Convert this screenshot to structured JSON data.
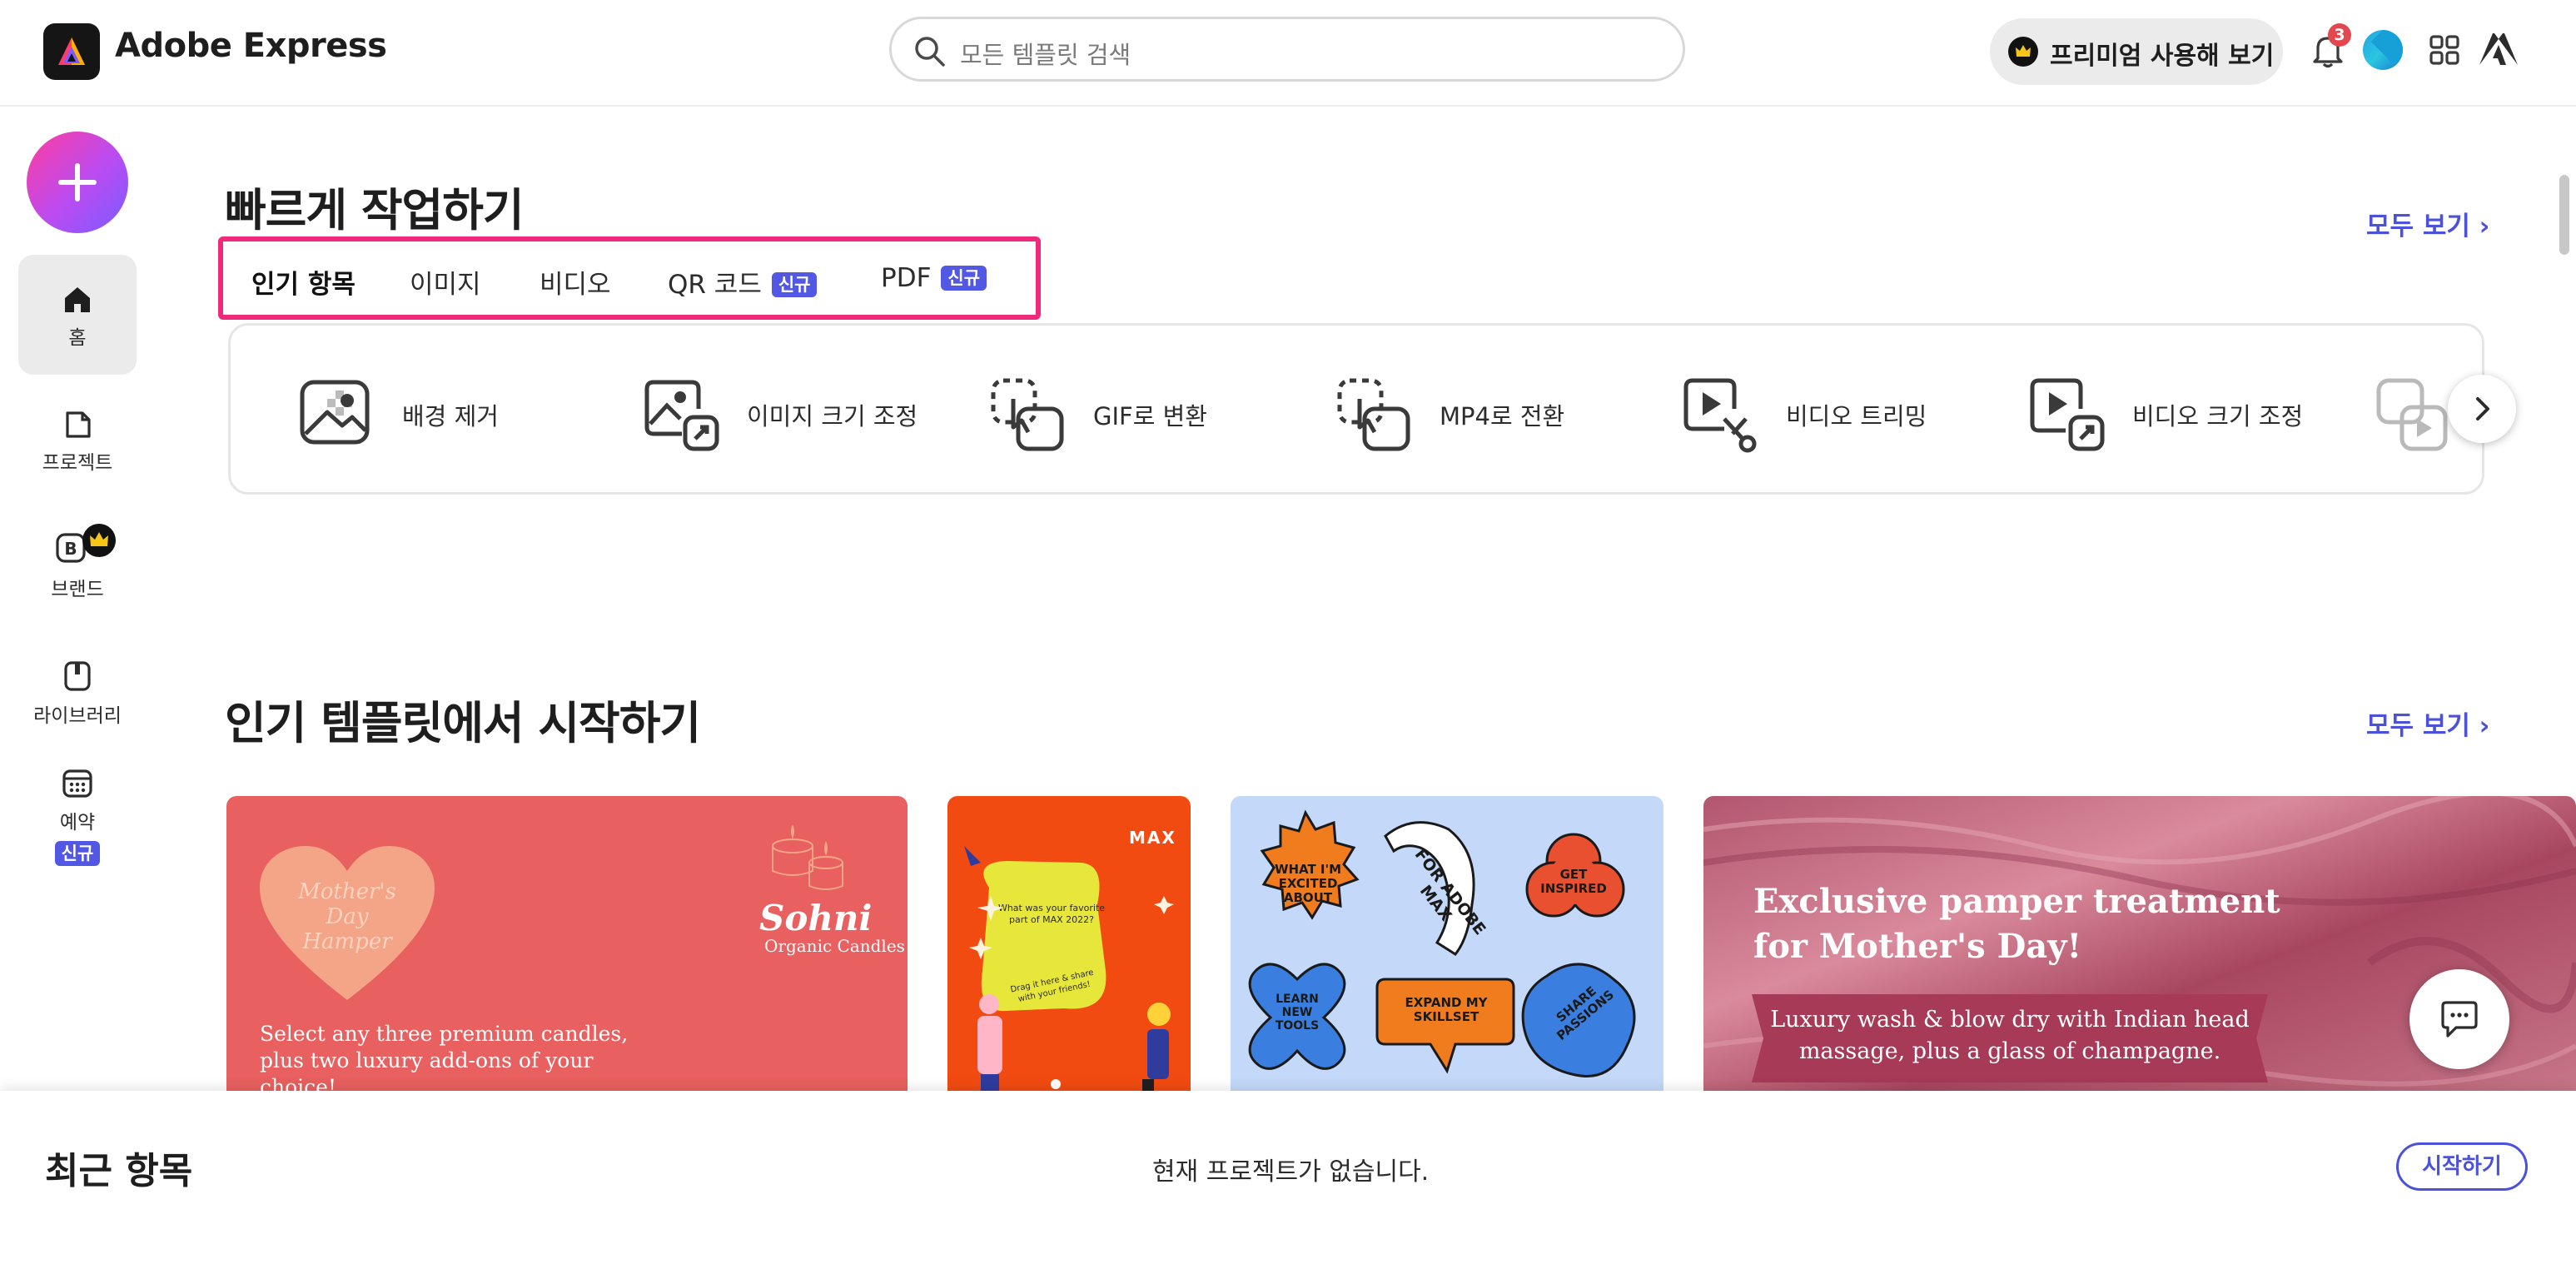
{
  "header": {
    "brand": "Adobe Express",
    "search_placeholder": "모든 템플릿 검색",
    "premium_label": "프리미엄 사용해 보기",
    "notification_count": "3"
  },
  "sidebar": {
    "items": [
      {
        "label": "홈",
        "icon": "home-icon"
      },
      {
        "label": "프로젝트",
        "icon": "projects-icon"
      },
      {
        "label": "브랜드",
        "icon": "brand-icon"
      },
      {
        "label": "라이브러리",
        "icon": "library-icon"
      },
      {
        "label": "예약",
        "icon": "calendar-icon"
      }
    ],
    "new_badge": "신규"
  },
  "quick_actions": {
    "title": "빠르게 작업하기",
    "see_all": "모두 보기 ›",
    "tabs": [
      {
        "label": "인기 항목",
        "active": true
      },
      {
        "label": "이미지"
      },
      {
        "label": "비디오"
      },
      {
        "label": "QR 코드",
        "badge": "신규"
      },
      {
        "label": "PDF",
        "badge": "신규"
      }
    ],
    "items": [
      {
        "label": "배경 제거",
        "icon": "remove-background-icon"
      },
      {
        "label": "이미지 크기 조정",
        "icon": "resize-image-icon"
      },
      {
        "label": "GIF로 변환",
        "icon": "convert-gif-icon"
      },
      {
        "label": "MP4로 전환",
        "icon": "convert-mp4-icon"
      },
      {
        "label": "비디오 트리밍",
        "icon": "trim-video-icon"
      },
      {
        "label": "비디오 크기 조정",
        "icon": "resize-video-icon"
      }
    ]
  },
  "templates": {
    "title": "인기 템플릿에서 시작하기",
    "see_all": "모두 보기 ›",
    "cards": [
      {
        "heart_text": "Mother's Day Hamper",
        "brand": "Sohni",
        "brand_sub": "Organic Candles",
        "body": "Select any three premium candles, plus two luxury add-ons of your choice!"
      },
      {
        "logo": "MAX",
        "note1": "What was your favorite part of MAX 2022?",
        "note2": "Drag it here & share with your friends!"
      },
      {
        "stickers": [
          "WHAT I'M EXCITED ABOUT",
          "FOR ADOBE MAX",
          "GET INSPIRED",
          "LEARN NEW TOOLS",
          "EXPAND MY SKILLSET",
          "SHARE PASSIONS"
        ]
      },
      {
        "headline1": "Exclusive pamper treatment",
        "headline2": "for Mother's Day!",
        "sub1": "Luxury wash & blow dry with Indian head",
        "sub2": "massage, plus a glass of champagne."
      }
    ]
  },
  "recent": {
    "title": "최근 항목",
    "empty_message": "현재 프로젝트가 없습니다.",
    "start_label": "시작하기"
  }
}
